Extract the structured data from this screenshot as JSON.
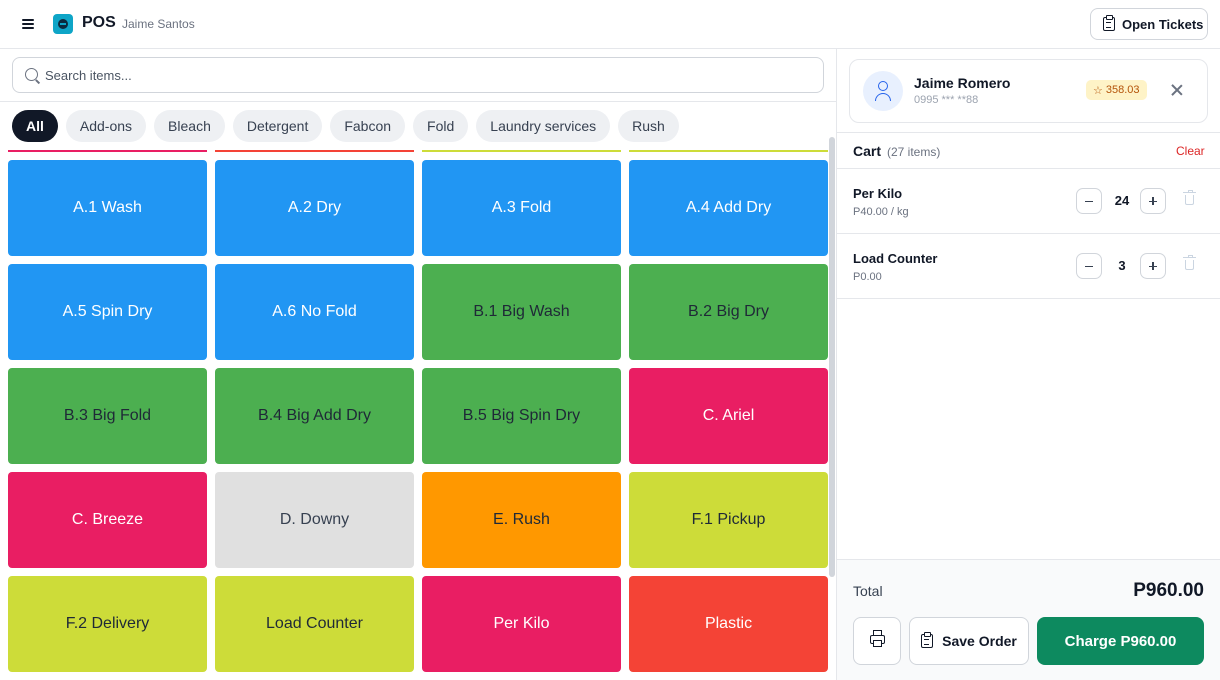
{
  "header": {
    "title": "POS",
    "user": "Jaime Santos",
    "open_tickets_label": "Open Tickets"
  },
  "search": {
    "placeholder": "Search items...",
    "value": ""
  },
  "categories": [
    "All",
    "Add-ons",
    "Bleach",
    "Detergent",
    "Fabcon",
    "Fold",
    "Laundry services",
    "Rush"
  ],
  "active_category": "All",
  "items": [
    {
      "label": "A.1 Wash",
      "color": "#2196f3",
      "text_color": "#ffffff"
    },
    {
      "label": "A.2 Dry",
      "color": "#2196f3",
      "text_color": "#ffffff"
    },
    {
      "label": "A.3 Fold",
      "color": "#2196f3",
      "text_color": "#ffffff"
    },
    {
      "label": "A.4 Add Dry",
      "color": "#2196f3",
      "text_color": "#ffffff"
    },
    {
      "label": "A.5 Spin Dry",
      "color": "#2196f3",
      "text_color": "#ffffff"
    },
    {
      "label": "A.6 No Fold",
      "color": "#2196f3",
      "text_color": "#ffffff"
    },
    {
      "label": "B.1 Big Wash",
      "color": "#4caf50",
      "text_color": "#1f2937"
    },
    {
      "label": "B.2 Big Dry",
      "color": "#4caf50",
      "text_color": "#1f2937"
    },
    {
      "label": "B.3 Big Fold",
      "color": "#4caf50",
      "text_color": "#1f2937"
    },
    {
      "label": "B.4 Big Add Dry",
      "color": "#4caf50",
      "text_color": "#1f2937"
    },
    {
      "label": "B.5 Big Spin Dry",
      "color": "#4caf50",
      "text_color": "#1f2937"
    },
    {
      "label": "C. Ariel",
      "color": "#e91e63",
      "text_color": "#ffffff"
    },
    {
      "label": "C. Breeze",
      "color": "#e91e63",
      "text_color": "#ffffff"
    },
    {
      "label": "D. Downy",
      "color": "#e0e0e0",
      "text_color": "#374151"
    },
    {
      "label": "E. Rush",
      "color": "#ff9800",
      "text_color": "#1f2937"
    },
    {
      "label": "F.1 Pickup",
      "color": "#cddc39",
      "text_color": "#1f2937"
    },
    {
      "label": "F.2 Delivery",
      "color": "#cddc39",
      "text_color": "#1f2937"
    },
    {
      "label": "Load Counter",
      "color": "#cddc39",
      "text_color": "#1f2937"
    },
    {
      "label": "Per Kilo",
      "color": "#e91e63",
      "text_color": "#ffffff"
    },
    {
      "label": "Plastic",
      "color": "#f44336",
      "text_color": "#ffffff"
    }
  ],
  "peek_colors": [
    "#e91e63",
    "#f44336",
    "#cddc39",
    "#cddc39"
  ],
  "customer": {
    "name": "Jaime Romero",
    "phone": "0995 *** **88",
    "points": "358.03"
  },
  "cart": {
    "title": "Cart",
    "count_label": "(27 items)",
    "clear_label": "Clear",
    "items": [
      {
        "name": "Per Kilo",
        "price": "P40.00 / kg",
        "qty": "24"
      },
      {
        "name": "Load Counter",
        "price": "P0.00",
        "qty": "3"
      }
    ]
  },
  "footer": {
    "total_label": "Total",
    "total_value": "P960.00",
    "save_label": "Save Order",
    "charge_label": "Charge P960.00"
  },
  "colors": {
    "accent": "#0d8a5f",
    "danger": "#dc2626",
    "points_bg": "#fef3c7"
  }
}
